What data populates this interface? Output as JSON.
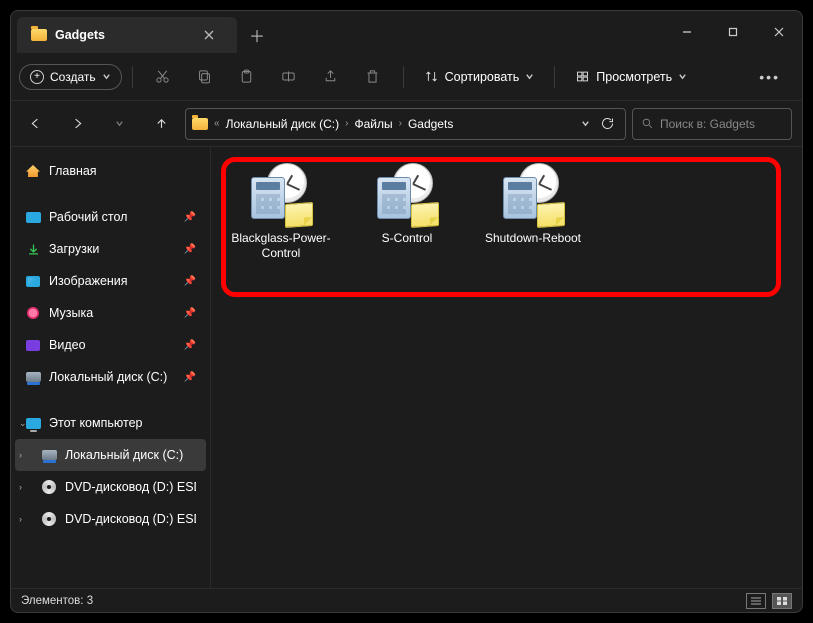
{
  "tab": {
    "title": "Gadgets"
  },
  "toolbar": {
    "create_label": "Создать",
    "sort_label": "Сортировать",
    "view_label": "Просмотреть"
  },
  "breadcrumbs": {
    "prefix": "«",
    "items": [
      "Локальный диск (C:)",
      "Файлы",
      "Gadgets"
    ]
  },
  "search": {
    "placeholder": "Поиск в: Gadgets"
  },
  "sidebar": {
    "home": "Главная",
    "quick": [
      {
        "label": "Рабочий стол"
      },
      {
        "label": "Загрузки"
      },
      {
        "label": "Изображения"
      },
      {
        "label": "Музыка"
      },
      {
        "label": "Видео"
      },
      {
        "label": "Локальный диск (C:)"
      }
    ],
    "this_pc": "Этот компьютер",
    "drives": [
      {
        "label": "Локальный диск (C:)"
      },
      {
        "label": "DVD-дисковод (D:) ESD-ISO"
      },
      {
        "label": "DVD-дисковод (D:) ESD-ISO"
      }
    ]
  },
  "files": [
    {
      "name": "Blackglass-Power-Control"
    },
    {
      "name": "S-Control"
    },
    {
      "name": "Shutdown-Reboot"
    }
  ],
  "status": {
    "items_label": "Элементов:",
    "count": "3"
  }
}
